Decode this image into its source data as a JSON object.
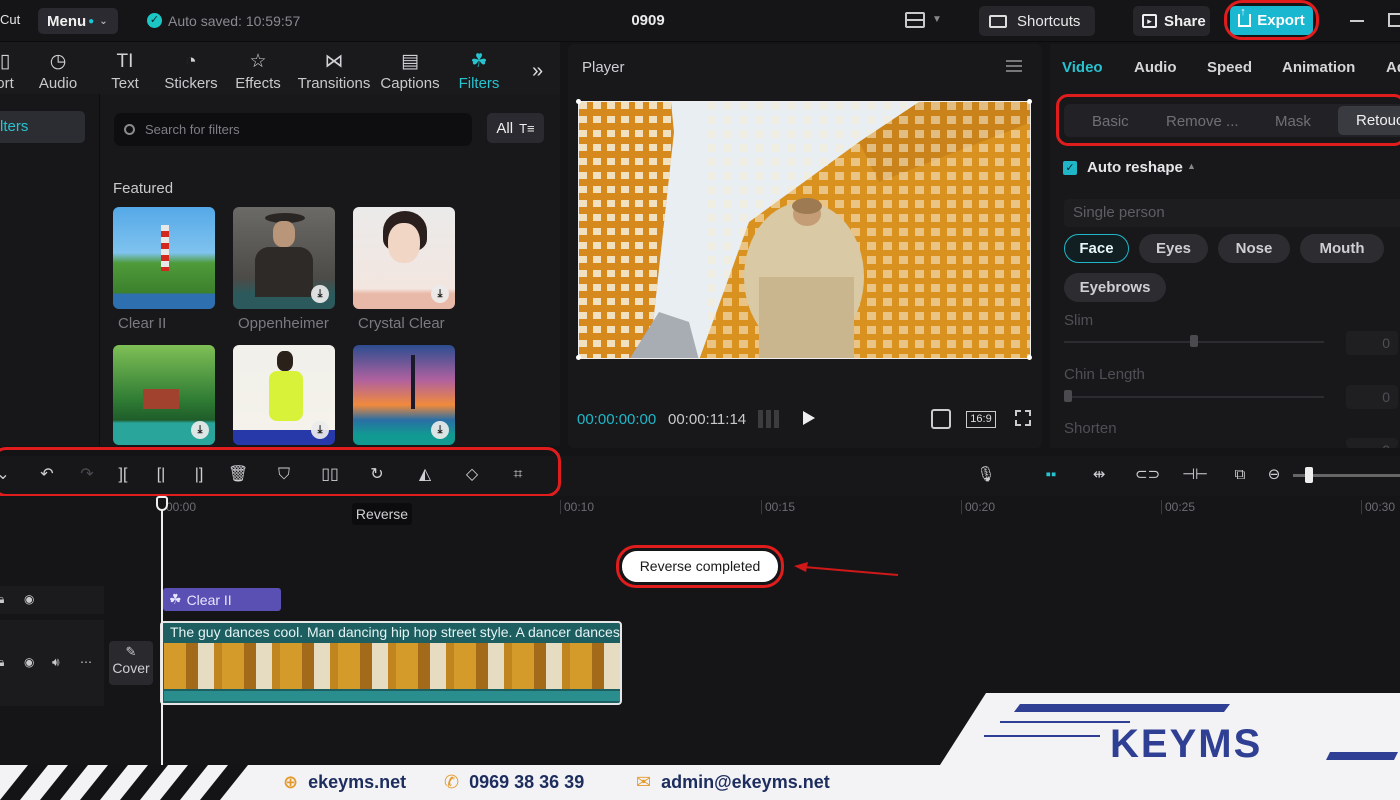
{
  "app": {
    "name": "Cut",
    "menu_label": "Menu",
    "autosave": "Auto saved: 10:59:57",
    "project_title": "0909"
  },
  "top_actions": {
    "shortcuts": "Shortcuts",
    "share": "Share",
    "export": "Export"
  },
  "media_tabs": [
    {
      "label": "ort",
      "icon": "import-icon"
    },
    {
      "label": "Audio",
      "icon": "audio-icon"
    },
    {
      "label": "Text",
      "icon": "text-icon"
    },
    {
      "label": "Stickers",
      "icon": "stickers-icon"
    },
    {
      "label": "Effects",
      "icon": "effects-icon"
    },
    {
      "label": "Transitions",
      "icon": "transitions-icon"
    },
    {
      "label": "Captions",
      "icon": "captions-icon"
    },
    {
      "label": "Filters",
      "icon": "filters-icon",
      "active": true
    }
  ],
  "left_nav": {
    "active_item": "lters"
  },
  "filters": {
    "search_placeholder": "Search for filters",
    "all_label": "All",
    "section_title": "Featured",
    "items": [
      {
        "label": "Clear II",
        "download": false
      },
      {
        "label": "Oppenheimer",
        "download": true
      },
      {
        "label": "Crystal Clear",
        "download": true
      },
      {
        "label": "",
        "download": true
      },
      {
        "label": "",
        "download": true
      },
      {
        "label": "",
        "download": true
      }
    ]
  },
  "player": {
    "title": "Player",
    "current_time": "00:00:00:00",
    "total_time": "00:00:11:14",
    "ratio": "16:9"
  },
  "inspector": {
    "tabs": [
      "Video",
      "Audio",
      "Speed",
      "Animation",
      "Ad"
    ],
    "active_tab": "Video",
    "subtabs": [
      "Basic",
      "Remove ...",
      "Mask",
      "Retouch"
    ],
    "active_subtab": "Retouc",
    "auto_reshape": "Auto reshape",
    "person_select": "Single person",
    "features": [
      "Face",
      "Eyes",
      "Nose",
      "Mouth",
      "Eyebrows"
    ],
    "active_feature": "Face",
    "sliders": [
      {
        "label": "Slim",
        "value": "0"
      },
      {
        "label": "Chin Length",
        "value": "0"
      },
      {
        "label": "Shorten",
        "value": "0"
      }
    ]
  },
  "timeline": {
    "ruler": [
      "00:00",
      "00:10",
      "00:15",
      "00:20",
      "00:25",
      "00:30"
    ],
    "tooltip": "Reverse",
    "toast": "Reverse completed",
    "filter_clip": "Clear II",
    "video_clip_title": "The guy dances cool. Man dancing hip hop street style. A dancer dances",
    "cover_label": "Cover"
  },
  "footer": {
    "website": "ekeyms.net",
    "phone": "0969 38 36 39",
    "email": "admin@ekeyms.net",
    "logo": "KEYMS"
  },
  "colors": {
    "accent": "#1fb7c8",
    "highlight_ring": "#e11c1c",
    "filter_clip": "#5a4fb3",
    "footer_text": "#1d2d5e"
  }
}
